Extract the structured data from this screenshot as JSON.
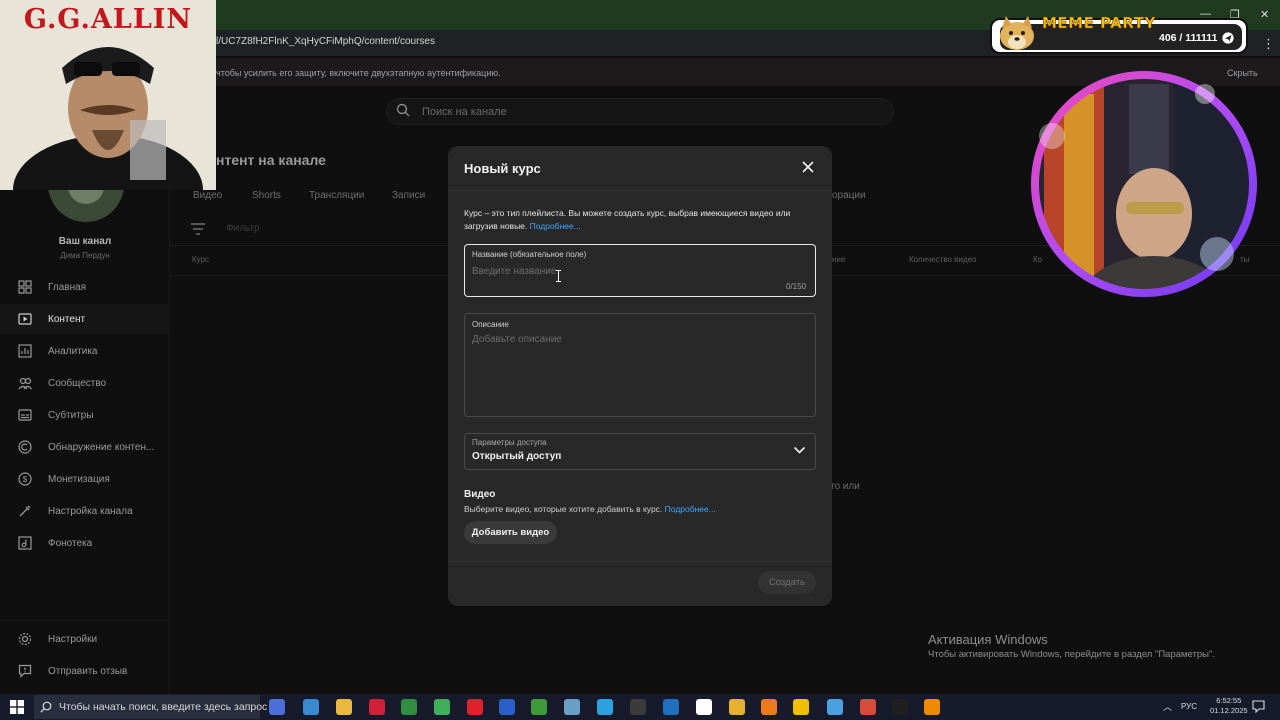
{
  "browser": {
    "url": "l/UC7Z8fH2FlnK_XqHyCFiMphQ/content/courses",
    "window_controls": [
      "—",
      "❐",
      "✕"
    ],
    "menu_glyph": "⋮"
  },
  "notice": {
    "text": "чтобы усилить его защиту, включите двухэтапную аутентификацию.",
    "hide": "Скрыть"
  },
  "search": {
    "placeholder": "Поиск на канале"
  },
  "channel": {
    "label": "Ваш канал",
    "handle": "Дима Пердун"
  },
  "sidebar": {
    "items": [
      {
        "label": "Главная",
        "icon": "dashboard-icon"
      },
      {
        "label": "Контент",
        "icon": "content-icon",
        "active": true
      },
      {
        "label": "Аналитика",
        "icon": "analytics-icon"
      },
      {
        "label": "Сообщество",
        "icon": "community-icon"
      },
      {
        "label": "Субтитры",
        "icon": "subtitles-icon"
      },
      {
        "label": "Обнаружение контен...",
        "icon": "copyright-icon"
      },
      {
        "label": "Монетизация",
        "icon": "monetization-icon"
      },
      {
        "label": "Настройка канала",
        "icon": "customization-icon"
      },
      {
        "label": "Фонотека",
        "icon": "audio-library-icon"
      }
    ],
    "bottom": [
      {
        "label": "Настройки",
        "icon": "gear-icon"
      },
      {
        "label": "Отправить отзыв",
        "icon": "feedback-icon"
      }
    ]
  },
  "content": {
    "title": "нтент на канале",
    "tabs": [
      "Видео",
      "Shorts",
      "Трансляции",
      "Записи",
      "орации"
    ],
    "filter": "Фильтр",
    "columns": [
      "Курс",
      "ние",
      "Количество видео",
      "Ко",
      "ты"
    ],
    "empty_hint": "то или"
  },
  "dialog": {
    "title": "Новый курс",
    "description": "Курс – это тип плейлиста. Вы можете создать курс, выбрав имеющиеся видео или загрузив новые.",
    "description_link": "Подробнее...",
    "name_label": "Название (обязательное поле)",
    "name_placeholder": "Введите название",
    "name_value": "",
    "name_counter": "0/150",
    "desc_label": "Описание",
    "desc_placeholder": "Добавьте описание",
    "access_label": "Параметры доступа",
    "access_value": "Открытый доступ",
    "video_title": "Видео",
    "video_hint": "Выберите видео, которые хотите добавить в курс.",
    "video_hint_link": "Подробнее...",
    "add_video": "Добавить видео",
    "create": "Создать"
  },
  "activation": {
    "title": "Активация Windows",
    "subtitle": "Чтобы активировать Windows, перейдите в раздел \"Параметры\"."
  },
  "taskbar": {
    "search_text": "Чтобы начать поиск, введите здесь запрос",
    "lang": "РУС",
    "time": "6:52:55",
    "date": "01.12.2025",
    "apps": [
      {
        "icon": "task-view-icon",
        "color": "#4b6fd6"
      },
      {
        "icon": "photos-icon",
        "color": "#3a8ad0"
      },
      {
        "icon": "file-explorer-icon",
        "color": "#e8b840"
      },
      {
        "icon": "opera-gx-icon",
        "color": "#d0203a"
      },
      {
        "icon": "excel-addin-icon",
        "color": "#2f8f3f"
      },
      {
        "icon": "spreadsheet-icon",
        "color": "#3fae5a"
      },
      {
        "icon": "opera-icon",
        "color": "#e0202a"
      },
      {
        "icon": "word-icon",
        "color": "#2b5fc7"
      },
      {
        "icon": "play-app-icon",
        "color": "#3f9a3a"
      },
      {
        "icon": "folder-app-icon",
        "color": "#6aa0c8"
      },
      {
        "icon": "telegram-icon",
        "color": "#2aa3df"
      },
      {
        "icon": "obs-icon",
        "color": "#3a3a3a"
      },
      {
        "icon": "photoshop-icon",
        "color": "#1f6fbf"
      },
      {
        "icon": "yandex-icon",
        "color": "#ffffff"
      },
      {
        "icon": "chrome-icon",
        "color": "#e6b12c"
      },
      {
        "icon": "firefox-icon",
        "color": "#ef7a1a"
      },
      {
        "icon": "bars-app-icon",
        "color": "#f0c000"
      },
      {
        "icon": "chrome-alt-icon",
        "color": "#4aa0e0"
      },
      {
        "icon": "chrome-profile-icon",
        "color": "#d84a3a"
      },
      {
        "icon": "capcut-icon",
        "color": "#1f1f1f"
      },
      {
        "icon": "vlc-icon",
        "color": "#f08a00"
      }
    ]
  },
  "overlays": {
    "left_cam_title": "G.G.ALLIN",
    "meme_title": "MEME PARTY",
    "meme_count": "406 / 111111"
  },
  "colors": {
    "accent_link": "#3ea6ff",
    "ring_purple": "#b04bf5",
    "ring_pink": "#f04ab8",
    "meme_yellow": "#f4c300"
  }
}
